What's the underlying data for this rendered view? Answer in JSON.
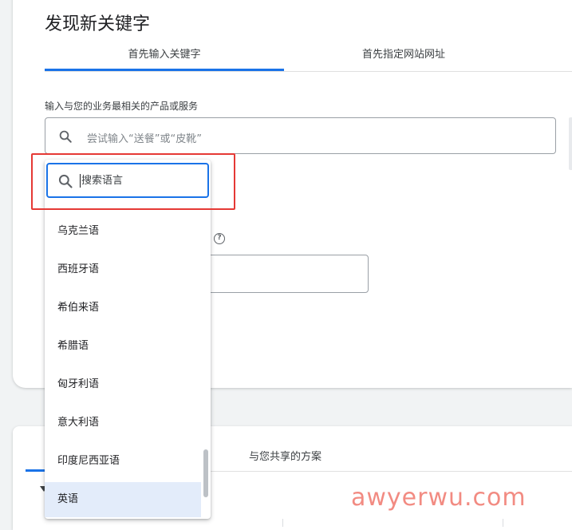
{
  "header": {
    "title": "发现新关键字"
  },
  "tabs": [
    {
      "label": "首先输入关键字",
      "active": true
    },
    {
      "label": "首先指定网站网址",
      "active": false
    }
  ],
  "keyword_field": {
    "label": "输入与您的业务最相关的产品或服务",
    "placeholder": "尝试输入“送餐”或“皮靴”"
  },
  "language_dropdown": {
    "search_placeholder": "搜索语言",
    "options": [
      {
        "label": "乌克兰语",
        "selected": false
      },
      {
        "label": "西班牙语",
        "selected": false
      },
      {
        "label": "希伯来语",
        "selected": false
      },
      {
        "label": "希腊语",
        "selected": false
      },
      {
        "label": "匈牙利语",
        "selected": false
      },
      {
        "label": "意大利语",
        "selected": false
      },
      {
        "label": "印度尼西亚语",
        "selected": false
      },
      {
        "label": "英语",
        "selected": true
      }
    ]
  },
  "help_icon_glyph": "?",
  "lower_card": {
    "tab_label": "与您共享的方案"
  },
  "watermark": "awyerwu.com",
  "colors": {
    "accent": "#1a73e8",
    "highlight_box": "#e53935",
    "selected_bg": "#e3ecfa"
  }
}
